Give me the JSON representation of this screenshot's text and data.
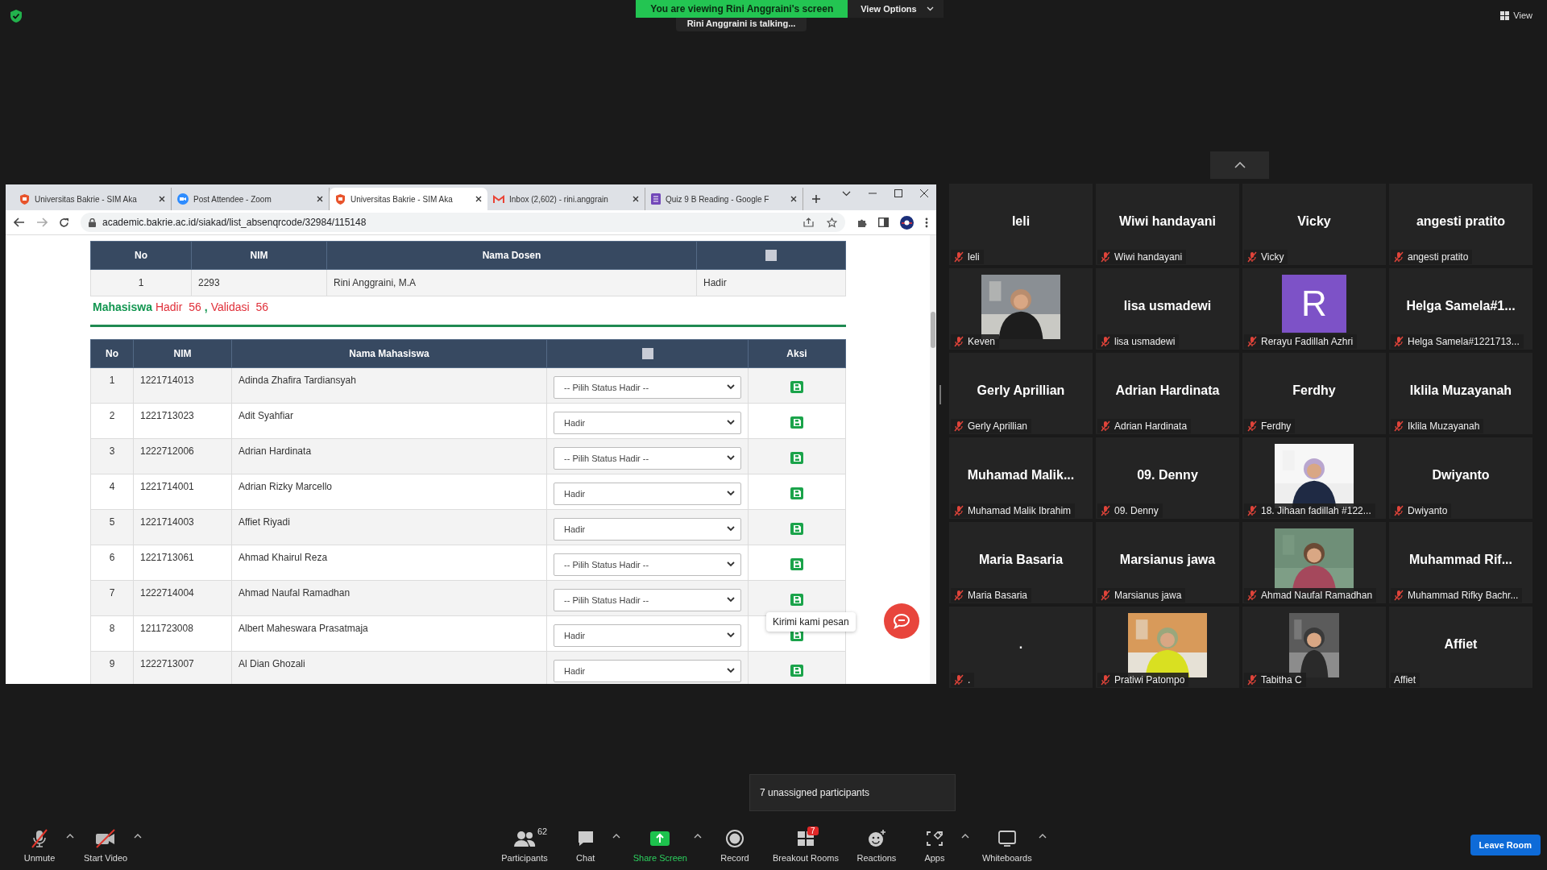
{
  "meeting": {
    "banner": "You are viewing Rini Anggraini's screen",
    "view_options": "View Options",
    "talking": "Rini Anggraini is talking...",
    "view_button": "View"
  },
  "browser": {
    "tabs": [
      {
        "title": "Universitas Bakrie - SIM Aka",
        "selected": false
      },
      {
        "title": "Post Attendee - Zoom",
        "selected": false
      },
      {
        "title": "Universitas Bakrie - SIM Aka",
        "selected": true
      },
      {
        "title": "Inbox (2,602) - rini.anggrain",
        "selected": false
      },
      {
        "title": "Quiz 9 B Reading - Google F",
        "selected": false
      }
    ],
    "url": "academic.bakrie.ac.id/siakad/list_absenqrcode/32984/115148"
  },
  "dosen_table": {
    "columns": [
      "No",
      "NIM",
      "Nama Dosen"
    ],
    "header_checked": false,
    "rows": [
      {
        "no": "1",
        "nim": "2293",
        "name": "Rini Anggraini, M.A",
        "status": "Hadir"
      }
    ]
  },
  "summary": {
    "label": "Mahasiswa",
    "hadir_label": "Hadir",
    "hadir_count": "56",
    "separator": ",",
    "validasi_label": "Validasi",
    "validasi_count": "56"
  },
  "student_table": {
    "columns": [
      "No",
      "NIM",
      "Nama Mahasiswa"
    ],
    "header_checked": false,
    "action_column": "Aksi",
    "rows": [
      {
        "no": "1",
        "nim": "1221714013",
        "name": "Adinda Zhafira Tardiansyah",
        "status": "-- Pilih Status Hadir --"
      },
      {
        "no": "2",
        "nim": "1221713023",
        "name": "Adit Syahfiar",
        "status": "Hadir"
      },
      {
        "no": "3",
        "nim": "1222712006",
        "name": "Adrian Hardinata",
        "status": "-- Pilih Status Hadir --"
      },
      {
        "no": "4",
        "nim": "1221714001",
        "name": "Adrian Rizky Marcello",
        "status": "Hadir"
      },
      {
        "no": "5",
        "nim": "1221714003",
        "name": "Affiet Riyadi",
        "status": "Hadir"
      },
      {
        "no": "6",
        "nim": "1221713061",
        "name": "Ahmad Khairul Reza",
        "status": "-- Pilih Status Hadir --"
      },
      {
        "no": "7",
        "nim": "1222714004",
        "name": "Ahmad Naufal Ramadhan",
        "status": "-- Pilih Status Hadir --"
      },
      {
        "no": "8",
        "nim": "1211723008",
        "name": "Albert Maheswara Prasatmaja",
        "status": "Hadir"
      },
      {
        "no": "9",
        "nim": "1222713007",
        "name": "Al Dian Ghozali",
        "status": "Hadir"
      }
    ]
  },
  "chat_widget": {
    "tooltip": "Kirimi kami pesan"
  },
  "gallery": {
    "tiles": [
      {
        "kind": "name",
        "display": "leli",
        "label": "leli",
        "muted": true
      },
      {
        "kind": "name",
        "display": "Wiwi handayani",
        "label": "Wiwi handayani",
        "muted": true
      },
      {
        "kind": "name",
        "display": "Vicky",
        "label": "Vicky",
        "muted": true
      },
      {
        "kind": "name",
        "display": "angesti pratito",
        "label": "angesti pratito",
        "muted": true
      },
      {
        "kind": "picture",
        "label": "Keven",
        "muted": true
      },
      {
        "kind": "name",
        "display": "lisa usmadewi",
        "label": "lisa usmadewi",
        "muted": true
      },
      {
        "kind": "avatar",
        "display": "R",
        "label": "Rerayu Fadillah Azhri",
        "muted": true
      },
      {
        "kind": "name",
        "display": "Helga  Samela#1...",
        "label": "Helga Samela#1221713...",
        "muted": true
      },
      {
        "kind": "name",
        "display": "Gerly Aprillian",
        "label": "Gerly Aprillian",
        "muted": true
      },
      {
        "kind": "name",
        "display": "Adrian Hardinata",
        "label": "Adrian Hardinata",
        "muted": true
      },
      {
        "kind": "name",
        "display": "Ferdhy",
        "label": "Ferdhy",
        "muted": true
      },
      {
        "kind": "name",
        "display": "Iklila Muzayanah",
        "label": "Iklila Muzayanah",
        "muted": true
      },
      {
        "kind": "name",
        "display": "Muhamad  Malik...",
        "label": "Muhamad Malik Ibrahim",
        "muted": true
      },
      {
        "kind": "name",
        "display": "09. Denny",
        "label": "09. Denny",
        "muted": true
      },
      {
        "kind": "picture",
        "label": "18. Jihaan fadillah #122...",
        "muted": true
      },
      {
        "kind": "name",
        "display": "Dwiyanto",
        "label": "Dwiyanto",
        "muted": true
      },
      {
        "kind": "name",
        "display": "Maria Basaria",
        "label": "Maria Basaria",
        "muted": true
      },
      {
        "kind": "name",
        "display": "Marsianus jawa",
        "label": "Marsianus jawa",
        "muted": true
      },
      {
        "kind": "picture",
        "label": "Ahmad Naufal Ramadhan",
        "muted": true
      },
      {
        "kind": "name",
        "display": "Muhammad  Rif...",
        "label": "Muhammad Rifky Bachr...",
        "muted": true
      },
      {
        "kind": "name",
        "display": ".",
        "label": ".",
        "muted": true
      },
      {
        "kind": "picture",
        "label": "Pratiwi Patompo",
        "muted": true
      },
      {
        "kind": "picture",
        "label": "Tabitha C",
        "muted": true
      },
      {
        "kind": "name",
        "display": "Affiet",
        "label": "Affiet",
        "muted": false
      }
    ]
  },
  "breakout_tooltip": "7 unassigned participants",
  "toolbar": {
    "items": [
      {
        "label": "Unmute",
        "caret": true
      },
      {
        "label": "Start Video",
        "caret": true
      },
      {
        "label": "Participants",
        "count": "62",
        "caret": false
      },
      {
        "label": "Chat",
        "caret": true
      },
      {
        "label": "Share Screen",
        "caret": true
      },
      {
        "label": "Record",
        "caret": false
      },
      {
        "label": "Breakout Rooms",
        "badge": "7",
        "caret": false
      },
      {
        "label": "Reactions",
        "caret": false
      },
      {
        "label": "Apps",
        "caret": true
      },
      {
        "label": "Whiteboards",
        "caret": true
      }
    ],
    "leave": "Leave Room"
  }
}
